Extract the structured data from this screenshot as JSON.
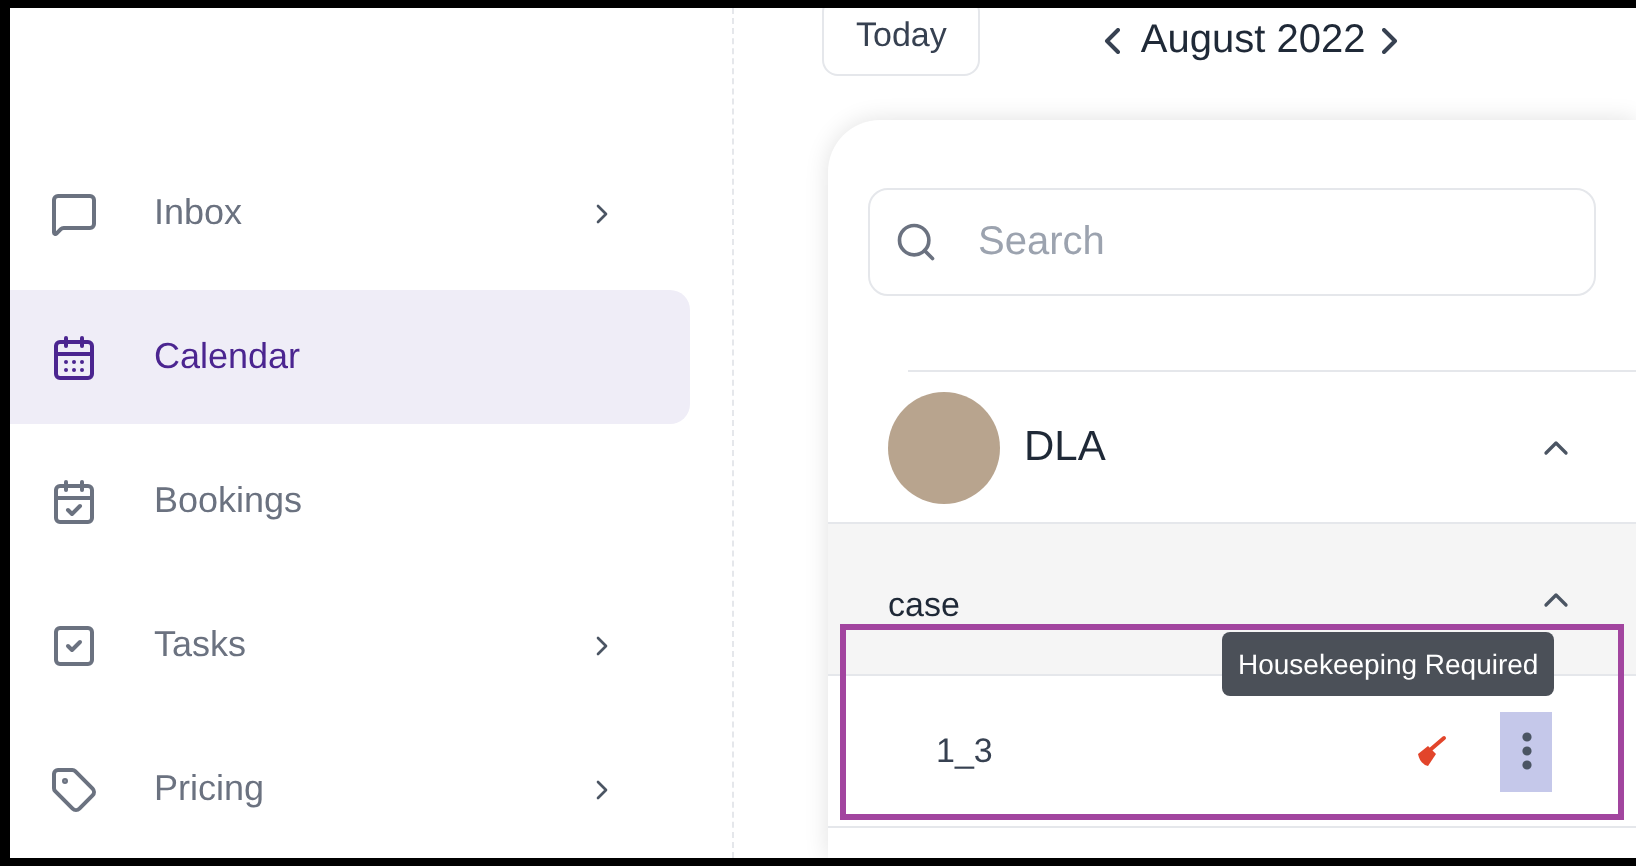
{
  "sidebar": {
    "items": [
      {
        "label": "Inbox",
        "selected": false,
        "has_submenu": true
      },
      {
        "label": "Calendar",
        "selected": true,
        "has_submenu": false
      },
      {
        "label": "Bookings",
        "selected": false,
        "has_submenu": false
      },
      {
        "label": "Tasks",
        "selected": false,
        "has_submenu": true
      },
      {
        "label": "Pricing",
        "selected": false,
        "has_submenu": true
      }
    ]
  },
  "toolbar": {
    "today_button": "Today",
    "month": "August 2022"
  },
  "panel": {
    "search": {
      "placeholder": "Search"
    },
    "property": {
      "name": "DLA",
      "expanded": true
    },
    "group": {
      "name": "case",
      "expanded": true
    },
    "unit": {
      "name": "1_3",
      "housekeeping_required": true,
      "tooltip": "Housekeeping Required"
    }
  }
}
